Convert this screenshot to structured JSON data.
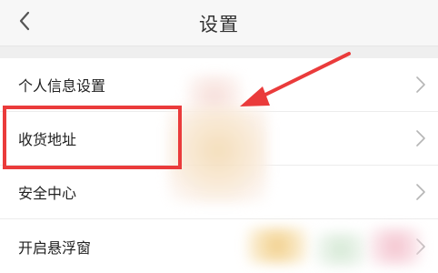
{
  "header": {
    "title": "设置",
    "back_icon": "chevron-left-icon"
  },
  "settings": {
    "items": [
      {
        "label": "个人信息设置",
        "icon": "chevron-right-icon"
      },
      {
        "label": "收货地址",
        "icon": "chevron-right-icon"
      },
      {
        "label": "安全中心",
        "icon": "chevron-right-icon"
      },
      {
        "label": "开启悬浮窗",
        "icon": "chevron-right-icon"
      }
    ]
  },
  "annotation": {
    "highlight_color": "#ea3b3b",
    "arrow_color": "#ea3b3b"
  }
}
